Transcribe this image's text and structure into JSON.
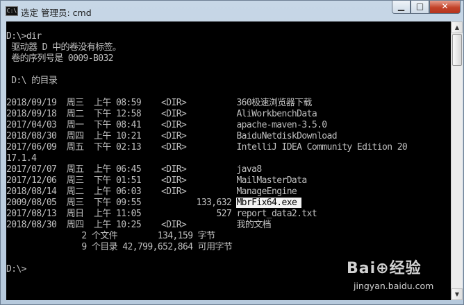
{
  "window": {
    "title": "选定 管理员: cmd",
    "icon_text": "C:\\",
    "minimize_glyph": "▁",
    "maximize_glyph": "□",
    "close_glyph": "✕"
  },
  "console": {
    "lines": [
      "D:\\>dir",
      " 驱动器 D 中的卷没有标签。",
      " 卷的序列号是 0009-B032",
      "",
      " D:\\ 的目录",
      "",
      "2018/09/19  周三  上午 08:59    <DIR>          360极速浏览器下载",
      "2018/09/18  周二  下午 12:58    <DIR>          AliWorkbenchData",
      "2017/04/03  周一  下午 08:41    <DIR>          apache-maven-3.5.0",
      "2018/08/30  周四  上午 10:21    <DIR>          BaiduNetdiskDownload",
      "2017/06/09  周五  下午 02:13    <DIR>          IntelliJ IDEA Community Edition 20",
      "17.1.4",
      "2017/07/07  周五  上午 06:45    <DIR>          java8",
      "2017/12/06  周三  下午 01:51    <DIR>          MailMasterData",
      "2018/08/14  周二  上午 06:03    <DIR>          ManageEngine",
      "2009/08/05  周三  下午 09:55           133,632 ",
      "2017/08/13  周日  上午 11:05               527 report_data2.txt",
      "2018/08/30  周四  上午 10:25    <DIR>          我的文档",
      "               2 个文件        134,159 字节",
      "               9 个目录 42,799,652,864 可用字节",
      "",
      "D:\\>"
    ],
    "selected_text": "MbrFix64.exe "
  },
  "watermark": {
    "brand": "Bai⊕经验",
    "url": "jingyan.baidu.com"
  }
}
